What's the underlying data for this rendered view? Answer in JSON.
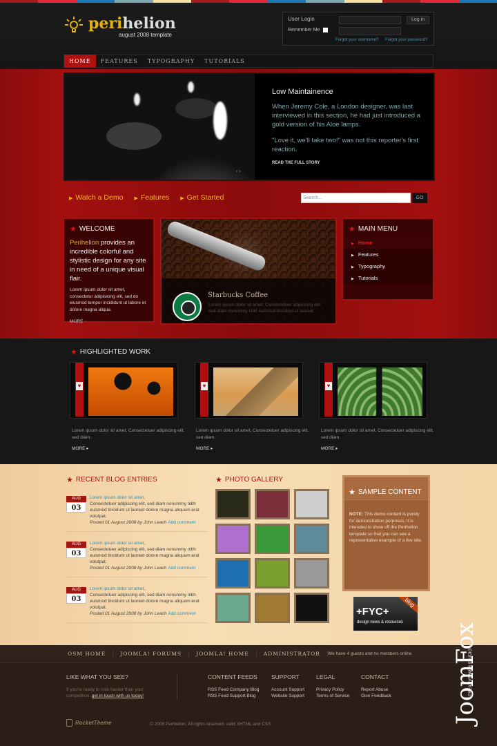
{
  "top_stripe_colors": [
    "#a51b1b",
    "#e6283c",
    "#1b79b5",
    "#7fa9b2",
    "#f6dfa3",
    "#a51b1b",
    "#e6283c",
    "#1b79b5",
    "#7fa9b2",
    "#f6dfa3",
    "#a51b1b",
    "#e6283c",
    "#1b79b5"
  ],
  "brand": {
    "logo_part1": "peri",
    "logo_part2": "helion",
    "tagline": "august 2008 template",
    "accent": "#e3b118",
    "icon": "lightbulb-icon"
  },
  "login": {
    "title": "User Login",
    "remember_label": "Remember Me",
    "button_label": "Log in",
    "forgot_username": "Forgot your username?",
    "forgot_password": "Forgot your password?"
  },
  "nav": {
    "items": [
      {
        "label": "HOME",
        "active": true
      },
      {
        "label": "FEATURES"
      },
      {
        "label": "TYPOGRAPHY"
      },
      {
        "label": "TUTORIALS"
      }
    ]
  },
  "hero": {
    "title": "Low Maintainence",
    "para1": "When Jeremy Cole, a London designer, was last interviewed in this section, he had just introduced a gold version of his Aloe lamps.",
    "para2": "\"Love it, we'll take two!\" was not this reporter's first reaction.",
    "link": "READ THE FULL STORY",
    "arrows": "‹ ›"
  },
  "quicklinks": [
    "Watch a Demo",
    "Features",
    "Get Started"
  ],
  "search": {
    "placeholder": "Search...",
    "button": "GO"
  },
  "welcome": {
    "title": "WELCOME",
    "lead_highlight": "Perihelion",
    "lead_rest": " provides an incredible colorful and stylistic design for any site in need of a unique visual flair.",
    "body": "Lorem ipsum dolor sit amet, consectetur adipisicing elit, sed do eiusmod tempor incididunt ut labore et dolore magna aliqua.",
    "more": "MORE"
  },
  "feature": {
    "title": "Starbucks Coffee",
    "desc": "Lorem ipsum dolor sit amet, Consectetuer adipiscing elit, sed diam nonummy nibh euismod tincidunt ut laoreet",
    "logo": "starbucks-logo"
  },
  "main_menu": {
    "title": "MAIN MENU",
    "items": [
      {
        "label": "Home",
        "active": true
      },
      {
        "label": "Features"
      },
      {
        "label": "Typography"
      },
      {
        "label": "Tutorials"
      }
    ]
  },
  "highlighted": {
    "title": "HIGHLIGHTED WORK",
    "items": [
      {
        "image": "orange-balloons",
        "text": "Lorem ipsum dolor sit amet, Consectetuer adipiscing elit, sed diam.",
        "more": "MORE"
      },
      {
        "image": "pyramids",
        "text": "Lorem ipsum dolor sit amet, Consectetuer adipiscing elit, sed diam.",
        "more": "MORE"
      },
      {
        "image": "man-in-maze",
        "text": "Lorem ipsum dolor sit amet, Consectetuer adipiscing elit, sed diam.",
        "more": "MORE"
      }
    ]
  },
  "blog": {
    "title": "RECENT BLOG ENTRIES",
    "entries": [
      {
        "month": "AUG",
        "day": "03",
        "heading": "Lorem ipsum dolor sit amet,",
        "body": "Consectetuer adipiscing elit, sed diam nonummy nibh euismod tincidunt ut laoreet dolore magna aliquam erat volutpat.",
        "posted": "Posted 01 August 2008 by John Leach",
        "comment": "Add comment"
      },
      {
        "month": "AUG",
        "day": "03",
        "heading": "Lorem ipsum dolor sit amet,",
        "body": "Consectetuer adipiscing elit, sed diam nonummy nibh euismod tincidunt ut laoreet dolore magna aliquam erat volutpat.",
        "posted": "Posted 01 August 2008 by John Leach",
        "comment": "Add comment"
      },
      {
        "month": "AUG",
        "day": "03",
        "heading": "Lorem ipsum dolor sit amet,",
        "body": "Consectetuer adipiscing elit, sed diam nonummy nibh euismod tincidunt ut laoreet dolore magna aliquam erat volutpat.",
        "posted": "Posted 01 August 2008 by John Leach",
        "comment": "Add comment"
      }
    ]
  },
  "gallery": {
    "title": "PHOTO GALLERY",
    "thumbs": [
      {
        "name": "abstract-circles",
        "color": "#2a2a1a"
      },
      {
        "name": "fabric",
        "color": "#7a2e3a"
      },
      {
        "name": "sketch-face",
        "color": "#cfcfcf"
      },
      {
        "name": "colorful-hands",
        "color": "#b070d0"
      },
      {
        "name": "green-drink",
        "color": "#3a9a3a"
      },
      {
        "name": "water-drop",
        "color": "#5f8a99"
      },
      {
        "name": "blue-waves",
        "color": "#1d6fb0"
      },
      {
        "name": "green-ferns",
        "color": "#7aa030"
      },
      {
        "name": "street-lamp",
        "color": "#999999"
      },
      {
        "name": "hands",
        "color": "#6aa890"
      },
      {
        "name": "wheat-field",
        "color": "#a07a30"
      },
      {
        "name": "rainbow-circles",
        "color": "#111111"
      }
    ]
  },
  "sample": {
    "title": "SAMPLE CONTENT",
    "note_label": "NOTE:",
    "note": " This demo content is purely for demonstration purposes. It is intended to show off the Perihelion template so that you can see a representative example of a live site."
  },
  "fyc_banner": {
    "big": "+FYC+",
    "small": "design news & resources",
    "tag": "blog"
  },
  "footer": {
    "nav": [
      "OSM HOME",
      "JOOMLA! FORUMS",
      "JOOMLA! HOME",
      "ADMINISTRATOR"
    ],
    "online": "We have 4 guests and no members online",
    "like": {
      "title": "LIKE WHAT YOU SEE?",
      "text": "If you're ready to rock harder than your competition, ",
      "link": "get in touch with us today!"
    },
    "columns": [
      {
        "title": "CONTENT FEEDS",
        "links": [
          "RSS Feed Company Blog",
          "RSS Feed Support Blog"
        ]
      },
      {
        "title": "SUPPORT",
        "links": [
          "Account Support",
          "Website Support"
        ]
      },
      {
        "title": "LEGAL",
        "links": [
          "Privacy Policy",
          "Terms of Service"
        ]
      },
      {
        "title": "CONTACT",
        "links": [
          "Report Abuse",
          "Give Feedback"
        ]
      }
    ],
    "rockettheme": "RocketTheme",
    "copyright": "© 2008 Perihelion. All rights reserved. valid XHTML and CSS",
    "joomfox": {
      "name": "JoomFox",
      "sub": "CREATIVE WEB STUDIO"
    }
  }
}
